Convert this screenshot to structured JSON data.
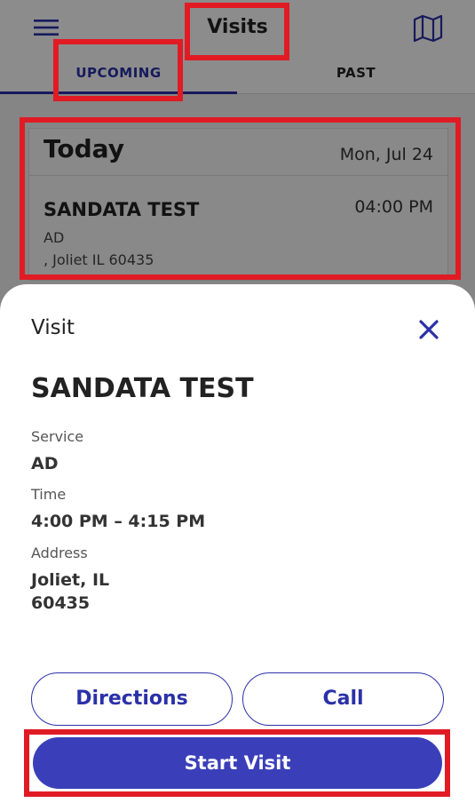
{
  "header": {
    "title": "Visits",
    "menu_icon": "hamburger-menu-icon",
    "map_icon": "map-icon"
  },
  "tabs": [
    {
      "label": "UPCOMING",
      "active": true
    },
    {
      "label": "PAST",
      "active": false
    }
  ],
  "schedule": {
    "day_label": "Today",
    "date": "Mon, Jul 24",
    "visits": [
      {
        "client_name": "SANDATA TEST",
        "time": "04:00 PM",
        "service": "AD",
        "address": ", Joliet IL 60435"
      }
    ]
  },
  "sheet": {
    "title": "Visit",
    "close_icon": "close-icon",
    "client_name": "SANDATA TEST",
    "service_label": "Service",
    "service_value": "AD",
    "time_label": "Time",
    "time_value": "4:00 PM – 4:15 PM",
    "address_label": "Address",
    "address_line1": "Joliet, IL",
    "address_line2": "60435",
    "directions_label": "Directions",
    "call_label": "Call",
    "start_visit_label": "Start Visit"
  },
  "colors": {
    "accent": "#2b31a8",
    "primary_button": "#3a3fb9",
    "highlight": "#e01b24"
  }
}
